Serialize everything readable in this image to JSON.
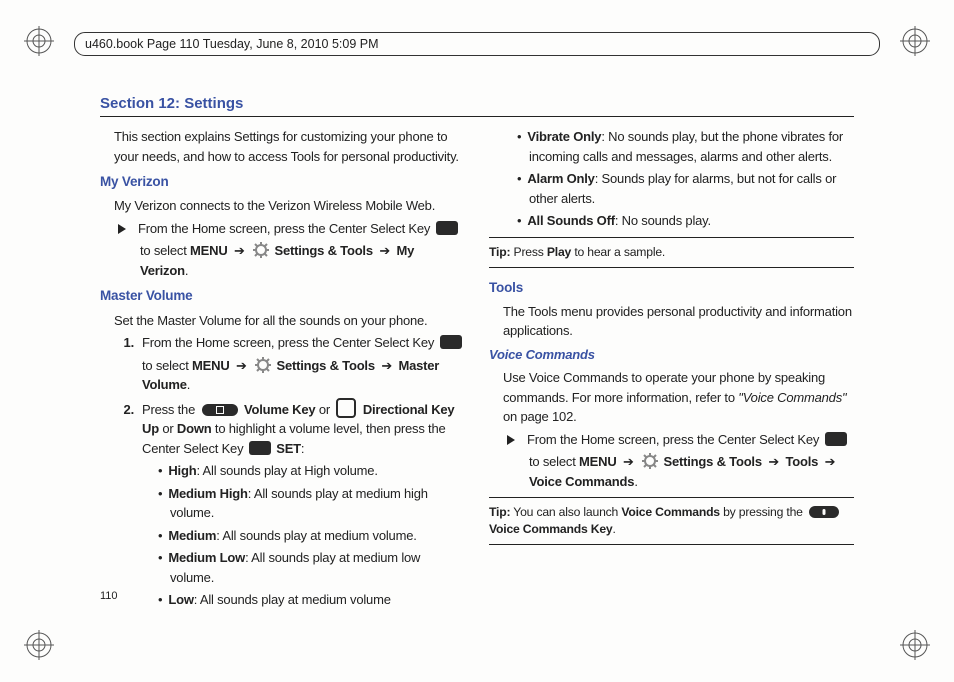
{
  "header": "u460.book  Page 110  Tuesday, June 8, 2010  5:09 PM",
  "section_title": "Section 12: Settings",
  "page_number": "110",
  "left": {
    "intro": "This section explains Settings for customizing your phone to your needs, and how to access Tools for personal productivity.",
    "h_myverizon": "My Verizon",
    "myverizon_body": "My Verizon connects to the Verizon Wireless Mobile Web.",
    "mv_step_a": "From the Home screen, press the Center Select Key",
    "mv_step_b1": "to select ",
    "mv_menu": "MENU",
    "mv_st": "Settings & Tools",
    "mv_target": "My Verizon",
    "h_master": "Master Volume",
    "master_body": "Set the Master Volume for all the sounds on your phone.",
    "s1_a": "From the Home screen, press the Center Select Key",
    "s1_target": "Master Volume",
    "s2_a": "Press the ",
    "s2_vk": "Volume Key",
    "s2_or": " or ",
    "s2_dk": "Directional Key Up",
    "s2_or2": " or ",
    "s2_down": "Down",
    "s2_tail": " to highlight a volume level, then press the Center Select Key ",
    "s2_set": "SET",
    "lvl_high_l": "High",
    "lvl_high_b": ": All sounds play at High volume.",
    "lvl_mh_l": "Medium High",
    "lvl_mh_b": ": All sounds play at medium high volume.",
    "lvl_m_l": "Medium",
    "lvl_m_b": ": All sounds play at medium volume.",
    "lvl_ml_l": "Medium Low",
    "lvl_ml_b": ": All sounds play at medium low volume.",
    "lvl_l_l": "Low",
    "lvl_l_b": ": All sounds play at medium volume"
  },
  "right": {
    "vo_l": "Vibrate Only",
    "vo_b": ": No sounds play, but the phone vibrates for incoming calls and messages, alarms and other alerts.",
    "ao_l": "Alarm Only",
    "ao_b": ": Sounds play for alarms, but not for calls or other alerts.",
    "aso_l": "All Sounds Off",
    "aso_b": ": No sounds play.",
    "tip1_l": "Tip:",
    "tip1_a": " Press ",
    "tip1_play": "Play",
    "tip1_b": " to hear a sample.",
    "h_tools": "Tools",
    "tools_body": "The Tools menu provides personal productivity and information applications.",
    "h_vc": "Voice Commands",
    "vc_body_a": "Use Voice Commands to operate your phone by speaking commands. For more information, refer to ",
    "vc_ref": "\"Voice Commands\"",
    "vc_body_b": " on page 102.",
    "vc_step_a": "From the Home screen, press the Center Select Key",
    "vc_menu": "MENU",
    "vc_st": "Settings & Tools",
    "vc_tools": "Tools",
    "vc_target": "Voice Commands",
    "tip2_l": "Tip:",
    "tip2_a": " You can also launch ",
    "tip2_vc": "Voice Commands",
    "tip2_b": " by pressing the ",
    "tip2_key": "Voice Commands Key"
  }
}
